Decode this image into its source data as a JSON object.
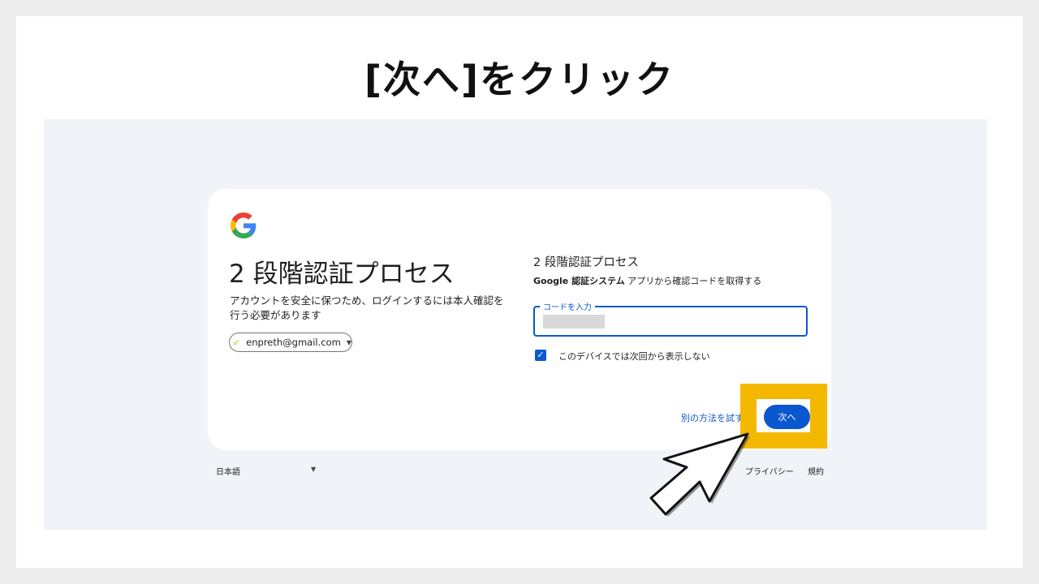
{
  "slide": {
    "title": "[次へ]をクリック"
  },
  "left_panel": {
    "heading": "2 段階認証プロセス",
    "description": "アカウントを安全に保つため、ログインするには本人確認を行う必要があります",
    "account_email": "enpreth@gmail.com"
  },
  "right_panel": {
    "title": "2 段階認証プロセス",
    "subtitle_bold": "Google 認証システム",
    "subtitle_rest": " アプリから確認コードを取得する",
    "code_field_label": "コードを入力",
    "checkbox_label": "このデバイスでは次回から表示しない",
    "checkbox_checked": true,
    "try_another_label": "別の方法を試す",
    "next_label": "次へ"
  },
  "footer": {
    "language": "日本語",
    "privacy": "プライバシー",
    "terms": "規約"
  },
  "colors": {
    "accent_blue": "#0b57d0",
    "highlight": "#f5b800",
    "page_bg": "#f0f3f8"
  },
  "icons": [
    "google-logo-icon",
    "key-icon",
    "chevron-down-icon",
    "checkmark-icon",
    "pointer-arrow-icon"
  ]
}
